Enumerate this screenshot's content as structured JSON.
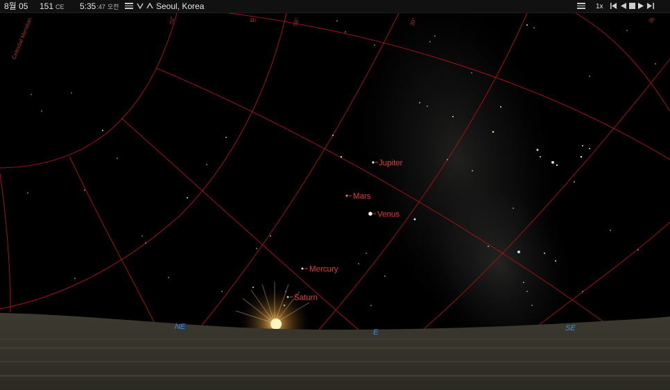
{
  "topbar": {
    "date": "8월 05",
    "year": "151",
    "era": "CE",
    "time": "5:35",
    "seconds": ":47",
    "ampm": "오전",
    "location": "Seoul, Korea",
    "speed": "1x"
  },
  "sky": {
    "meridian_label": "Celestial Meridian",
    "ra_labels": [
      "70°",
      "4h",
      "50°",
      "30°",
      "3h"
    ],
    "planets": [
      {
        "name": "Jupiter"
      },
      {
        "name": "Mars"
      },
      {
        "name": "Venus"
      },
      {
        "name": "Mercury"
      },
      {
        "name": "Saturn"
      }
    ],
    "compass": {
      "ne": "NE",
      "e": "E",
      "se": "SE"
    }
  },
  "colors": {
    "grid": "#a01414",
    "planet_label": "#e23a3a",
    "compass": "#3e8ee8",
    "ground": "#3a362c"
  }
}
